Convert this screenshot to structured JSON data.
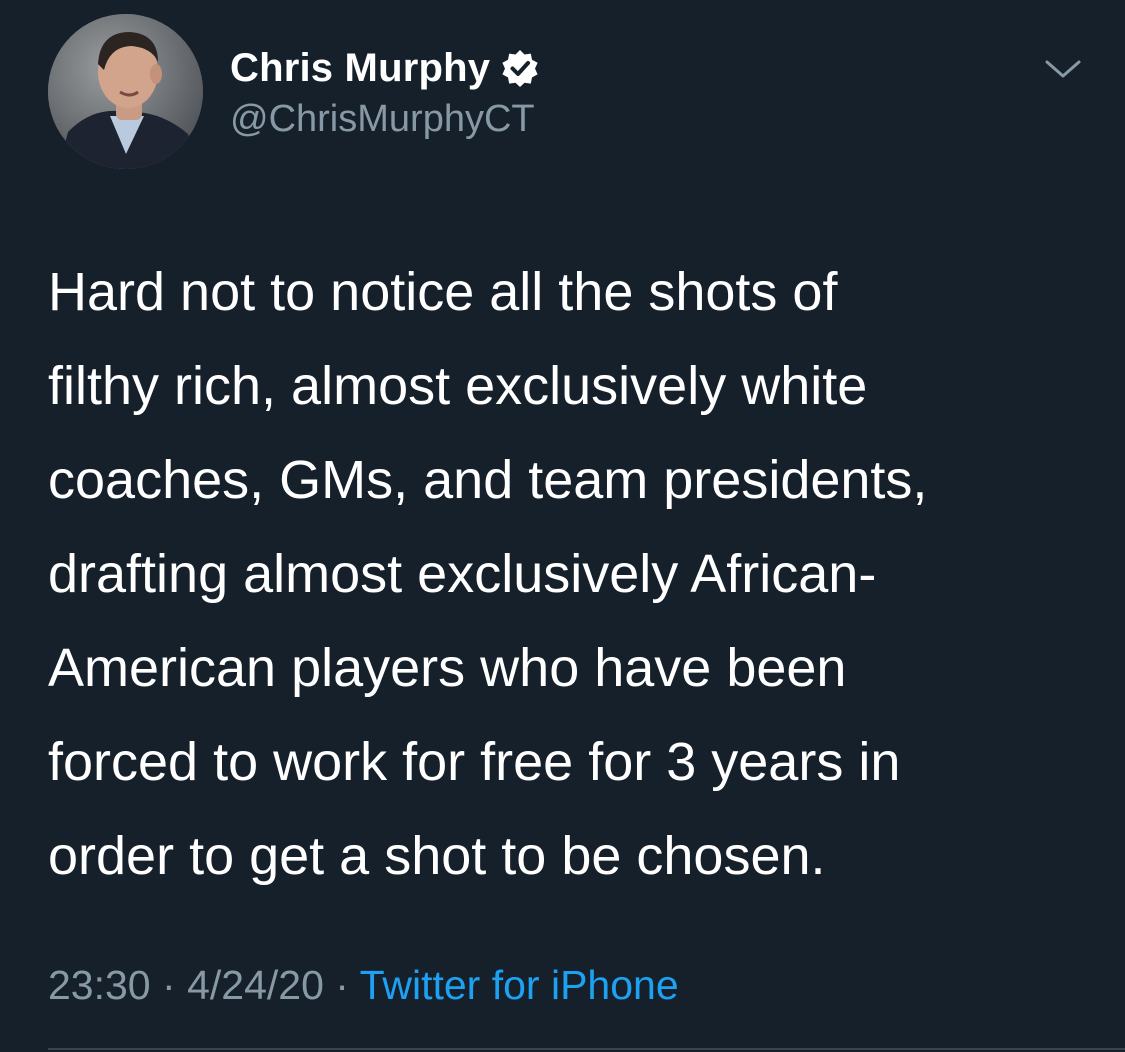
{
  "tweet": {
    "author": {
      "display_name": "Chris Murphy",
      "handle": "@ChrisMurphyCT",
      "verified": true,
      "avatar_icon": "profile-photo"
    },
    "text_lines": [
      "Hard not to notice all the shots of",
      "filthy rich, almost exclusively white",
      "coaches, GMs, and team presidents,",
      "drafting almost exclusively African-",
      "American players who have been",
      "forced to work for free for 3 years in",
      "order to get a shot to be chosen."
    ],
    "meta": {
      "time": "23:30",
      "date": "4/24/20",
      "separator": "·",
      "source": "Twitter for iPhone"
    },
    "menu_icon": "chevron-down-icon"
  },
  "colors": {
    "background": "#15202b",
    "primary_text": "#ffffff",
    "secondary_text": "#8899a6",
    "link": "#1da1f2",
    "divider": "#38444d"
  }
}
